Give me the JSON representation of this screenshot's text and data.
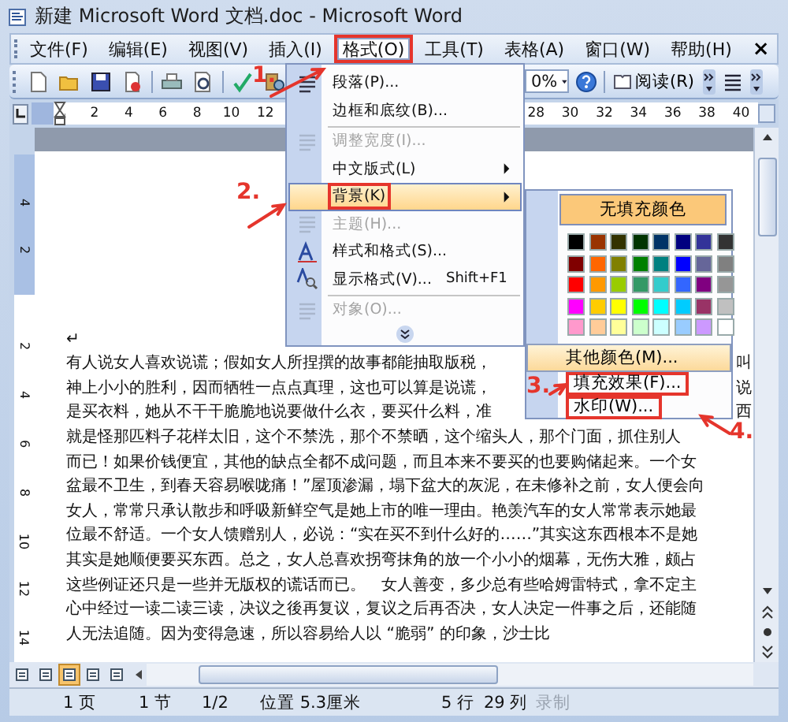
{
  "window": {
    "title": "新建 Microsoft Word 文档.doc - Microsoft Word"
  },
  "menu_bar": {
    "items": [
      {
        "label": "文件(F)",
        "selected": false,
        "annotated": false
      },
      {
        "label": "编辑(E)",
        "selected": false,
        "annotated": false
      },
      {
        "label": "视图(V)",
        "selected": false,
        "annotated": false
      },
      {
        "label": "插入(I)",
        "selected": false,
        "annotated": false
      },
      {
        "label": "格式(O)",
        "selected": true,
        "annotated": true
      },
      {
        "label": "工具(T)",
        "selected": false,
        "annotated": false
      },
      {
        "label": "表格(A)",
        "selected": false,
        "annotated": false
      },
      {
        "label": "窗口(W)",
        "selected": false,
        "annotated": false
      },
      {
        "label": "帮助(H)",
        "selected": false,
        "annotated": false
      }
    ],
    "close": "×"
  },
  "toolbar": {
    "zoom": "0%",
    "read_button": "阅读(R)"
  },
  "ruler": {
    "left_numbers": [
      "2",
      "4",
      "6",
      "8",
      "10",
      "12"
    ],
    "right_numbers": [
      "28",
      "30",
      "32",
      "34",
      "36",
      "38",
      "40"
    ]
  },
  "vertical_ruler": {
    "top_numbers": [
      "4",
      "2"
    ],
    "numbers": [
      "2",
      "4",
      "6",
      "8",
      "10",
      "12",
      "14"
    ]
  },
  "document": {
    "paragraph_mark": "↵",
    "lines": [
      {
        "text": "有人说女人喜欢说谎；假如女人所捏撰的故事都能抽取版税，",
        "tail": "叫"
      },
      {
        "text": "神上小小的胜利，因而牺牲一点点真理，这也可以算是说谎，",
        "tail": "说"
      },
      {
        "text": "是买衣料，她从不干干脆脆地说要做什么衣，要买什么料，准",
        "tail": "西"
      },
      {
        "text": "就是怪那匹料子花样太旧，这个不禁洗，那个不禁晒，这个缩头人，那个门面，抓住别人"
      },
      {
        "text": "而已！如果价钱便宜，其他的缺点全都不成问题，而且本来不要买的也要购储起来。一个女"
      },
      {
        "text": "盆最不卫生，到春天容易喉咙痛！”屋顶渗漏，塌下盆大的灰泥，在未修补之前，女人便会向"
      },
      {
        "text": "女人，常常只承认散步和呼吸新鲜空气是她上市的唯一理由。艳羡汽车的女人常常表示她最"
      },
      {
        "text": "位最不舒适。一个女人馈赠别人，必说：“实在买不到什么好的……”其实这东西根本不是她"
      },
      {
        "text": "其实是她顺便要买东西。总之，女人总喜欢拐弯抹角的放一个小小的烟幕，无伤大雅，颇占"
      },
      {
        "text": "这些例证还只是一些并无版权的谎话而已。　女人善变，多少总有些哈姆雷特式，拿不定主"
      },
      {
        "text": "心中经过一读二读三读，决议之後再复议，复议之后再否决，女人决定一件事之后，还能随"
      },
      {
        "text": "人无法追随。因为变得急速，所以容易给人以 “脆弱” 的印象，沙士比"
      }
    ]
  },
  "view_buttons": [
    {
      "selected": false
    },
    {
      "selected": false
    },
    {
      "selected": true
    },
    {
      "selected": false
    },
    {
      "selected": false
    }
  ],
  "status_bar": {
    "items": [
      {
        "text": "1 页",
        "disabled": false
      },
      {
        "text": "1 节",
        "disabled": false
      },
      {
        "text": "1/2",
        "disabled": false
      },
      {
        "text": "位置 5.3厘米",
        "disabled": false
      },
      {
        "text": "5 行",
        "disabled": false
      },
      {
        "text": "29 列",
        "disabled": false
      },
      {
        "text": "录制",
        "disabled": true
      }
    ]
  },
  "format_menu": {
    "items": [
      {
        "kind": "item",
        "label": "段落(P)...",
        "has_icon": true,
        "disabled": false,
        "selected": false,
        "annotated": false,
        "submenu": false
      },
      {
        "kind": "item",
        "label": "边框和底纹(B)...",
        "has_icon": false,
        "disabled": false,
        "selected": false,
        "annotated": false,
        "submenu": false
      },
      {
        "kind": "separator"
      },
      {
        "kind": "item",
        "label": "调整宽度(I)...",
        "has_icon": true,
        "disabled": true,
        "selected": false,
        "annotated": false,
        "submenu": false
      },
      {
        "kind": "item",
        "label": "中文版式(L)",
        "has_icon": false,
        "disabled": false,
        "selected": false,
        "annotated": false,
        "submenu": true
      },
      {
        "kind": "item",
        "label": "背景(K)",
        "has_icon": false,
        "disabled": false,
        "selected": true,
        "annotated": true,
        "submenu": true
      },
      {
        "kind": "item",
        "label": "主题(H)...",
        "has_icon": true,
        "disabled": true,
        "selected": false,
        "annotated": false,
        "submenu": false
      },
      {
        "kind": "item",
        "label": "样式和格式(S)...",
        "has_icon": true,
        "disabled": false,
        "selected": false,
        "annotated": false,
        "submenu": false
      },
      {
        "kind": "item",
        "label": "显示格式(V)...",
        "shortcut": "Shift+F1",
        "has_icon": true,
        "disabled": false,
        "selected": false,
        "annotated": false,
        "submenu": false
      },
      {
        "kind": "separator"
      },
      {
        "kind": "item",
        "label": "对象(O)...",
        "has_icon": true,
        "disabled": true,
        "selected": false,
        "annotated": false,
        "submenu": false
      },
      {
        "kind": "expand"
      }
    ]
  },
  "background_submenu": {
    "no_fill": "无填充颜色",
    "swatches": [
      {
        "color": "#000000"
      },
      {
        "color": "#993300"
      },
      {
        "color": "#333300"
      },
      {
        "color": "#003300"
      },
      {
        "color": "#003366"
      },
      {
        "color": "#000080"
      },
      {
        "color": "#333399"
      },
      {
        "color": "#333333"
      },
      {
        "color": "#800000"
      },
      {
        "color": "#ff6600"
      },
      {
        "color": "#808000"
      },
      {
        "color": "#008000"
      },
      {
        "color": "#008080"
      },
      {
        "color": "#0000ff"
      },
      {
        "color": "#666699"
      },
      {
        "color": "#808080"
      },
      {
        "color": "#ff0000"
      },
      {
        "color": "#ff9900"
      },
      {
        "color": "#99cc00"
      },
      {
        "color": "#339966"
      },
      {
        "color": "#33cccc"
      },
      {
        "color": "#3366ff"
      },
      {
        "color": "#800080"
      },
      {
        "color": "#969696"
      },
      {
        "color": "#ff00ff"
      },
      {
        "color": "#ffcc00"
      },
      {
        "color": "#ffff00"
      },
      {
        "color": "#00ff00"
      },
      {
        "color": "#00ffff"
      },
      {
        "color": "#00ccff"
      },
      {
        "color": "#993366"
      },
      {
        "color": "#c0c0c0"
      },
      {
        "color": "#ff99cc"
      },
      {
        "color": "#ffcc99"
      },
      {
        "color": "#ffff99"
      },
      {
        "color": "#ccffcc"
      },
      {
        "color": "#ccffff"
      },
      {
        "color": "#99ccff"
      },
      {
        "color": "#cc99ff"
      },
      {
        "color": "#ffffff"
      }
    ],
    "items": [
      {
        "kind": "more",
        "label": "其他颜色(M)...",
        "annotated": false
      },
      {
        "kind": "item",
        "label": "填充效果(F)...",
        "annotated": true
      },
      {
        "kind": "item",
        "label": "水印(W)...",
        "annotated": true
      }
    ]
  },
  "annotations": [
    {
      "label": "1."
    },
    {
      "label": "2."
    },
    {
      "label": "3."
    },
    {
      "label": "4."
    }
  ]
}
